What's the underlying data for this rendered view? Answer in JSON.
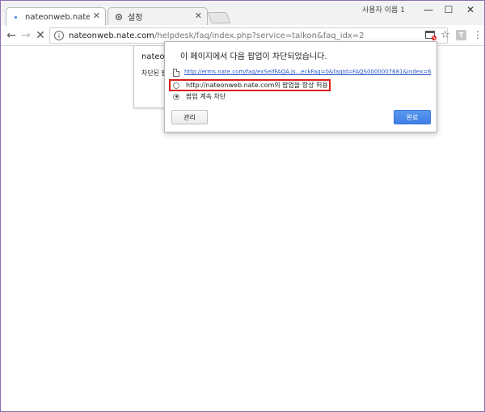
{
  "window": {
    "user_label": "사용자 이름 1",
    "minimize": "—",
    "maximize": "☐",
    "close": "✕"
  },
  "tabs": [
    {
      "title": "nateonweb.nate.com/he",
      "close": "✕",
      "active": true
    },
    {
      "title": "설정",
      "close": "✕",
      "active": false
    }
  ],
  "toolbar": {
    "back": "←",
    "forward": "→",
    "reload": "✕",
    "url_host": "nateonweb.nate.com",
    "url_path": "/helpdesk/faq/index.php?service=talkon&faq_idx=2",
    "info": "i",
    "star": "☆",
    "ext_label": "T",
    "menu": "⋮"
  },
  "page": {
    "dialog_title": "nateo",
    "dialog_text": "차단된 팝"
  },
  "popup_bubble": {
    "heading": "이 페이지에서 다음 팝업이 차단되었습니다.",
    "blocked_link": "http://erms.nate.com/faq/exSelfFAQA.js...eckFaq=0&faqId=FAQS0000007681&index=6",
    "option_allow": "http://nateonweb.nate.com의 팝업을 항상 허용",
    "option_block": "팝업 계속 차단",
    "manage_label": "관리",
    "done_label": "완료"
  },
  "colors": {
    "highlight": "#d91c1c",
    "primary_button": "#3f7fe6",
    "link": "#2a55c9"
  }
}
